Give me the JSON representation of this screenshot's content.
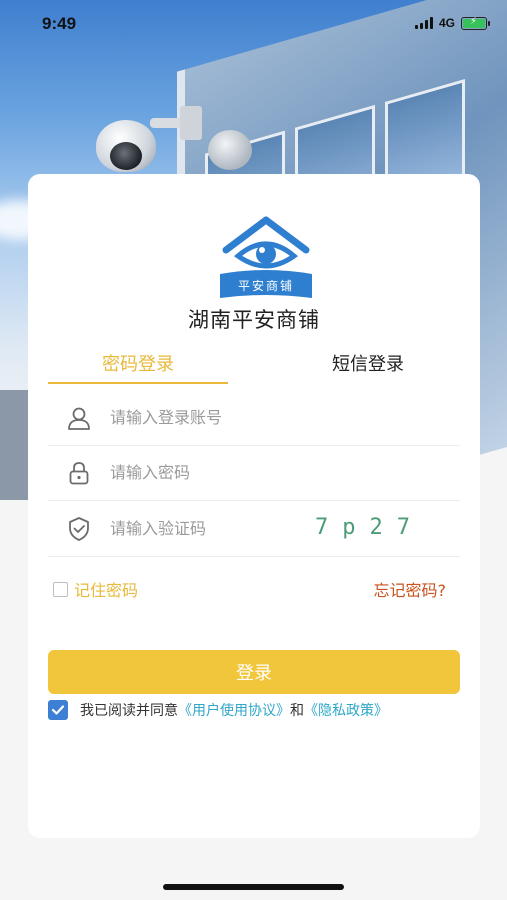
{
  "status_bar": {
    "time": "9:49",
    "network": "4G"
  },
  "brand": {
    "logo_text": "平安商铺",
    "title": "湖南平安商铺"
  },
  "tabs": [
    {
      "label": "密码登录",
      "active": true
    },
    {
      "label": "短信登录",
      "active": false
    }
  ],
  "form": {
    "account_placeholder": "请输入登录账号",
    "password_placeholder": "请输入密码",
    "code_placeholder": "请输入验证码",
    "captcha": "7p27"
  },
  "remember_label": "记住密码",
  "forgot_label": "忘记密码?",
  "login_label": "登录",
  "agreement": {
    "prefix": "我已阅读并同意",
    "user_agreement": "《用户使用协议》",
    "and": "和",
    "privacy_policy": "《隐私政策》",
    "checked": true
  },
  "colors": {
    "accent": "#f1c63a",
    "tab_active": "#e8b93a",
    "forgot": "#c8531f",
    "link": "#2fa7c9",
    "checkbox": "#3e7fd6",
    "captcha": "#4c9c78"
  }
}
